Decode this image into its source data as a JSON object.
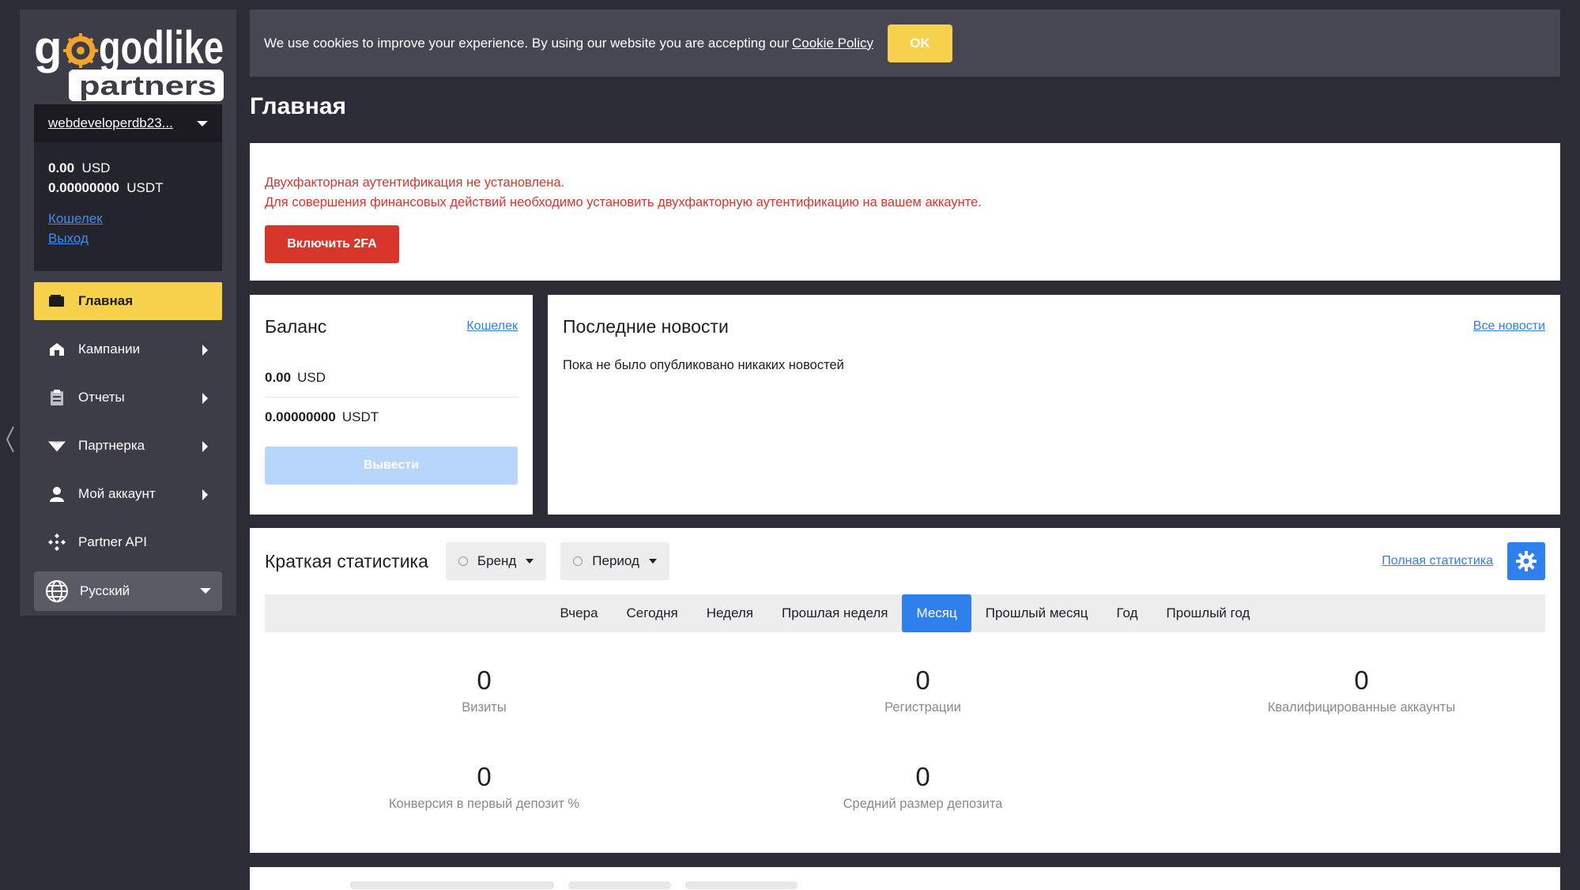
{
  "brand": {
    "line1": "godlike",
    "line2": "partners"
  },
  "account": {
    "username": "webdeveloperdb23...",
    "balances": [
      {
        "amount": "0.00",
        "currency": "USD"
      },
      {
        "amount": "0.00000000",
        "currency": "USDT"
      }
    ],
    "wallet_link": "Кошелек",
    "logout_link": "Выход"
  },
  "nav": [
    {
      "label": "Главная",
      "icon": "wallet-icon",
      "active": true
    },
    {
      "label": "Кампании",
      "icon": "home-icon",
      "submenu": true
    },
    {
      "label": "Отчеты",
      "icon": "clipboard-icon",
      "submenu": true
    },
    {
      "label": "Партнерка",
      "icon": "diamond-icon",
      "submenu": true
    },
    {
      "label": "Мой аккаунт",
      "icon": "user-icon",
      "submenu": true
    },
    {
      "label": "Partner API",
      "icon": "api-icon"
    }
  ],
  "language": "Русский",
  "cookie": {
    "text": "We use cookies to improve your experience. By using our website you are accepting our",
    "link": "Cookie Policy",
    "ok": "OK"
  },
  "page_title": "Главная",
  "alert": {
    "line1": "Двухфакторная аутентификация не установлена.",
    "line2": "Для совершения финансовых действий необходимо установить двухфакторную аутентификацию на вашем аккаунте.",
    "button": "Включить 2FA"
  },
  "balance_card": {
    "title": "Баланс",
    "link": "Кошелек",
    "rows": [
      {
        "amount": "0.00",
        "currency": "USD"
      },
      {
        "amount": "0.00000000",
        "currency": "USDT"
      }
    ],
    "button": "Вывести"
  },
  "news_card": {
    "title": "Последние новости",
    "link": "Все новости",
    "empty": "Пока не было опубликовано никаких новостей"
  },
  "stats": {
    "title": "Краткая статистика",
    "filters": [
      "Бренд",
      "Период"
    ],
    "full_link": "Полная статистика",
    "tabs": [
      "Вчера",
      "Сегодня",
      "Неделя",
      "Прошлая неделя",
      "Месяц",
      "Прошлый месяц",
      "Год",
      "Прошлый год"
    ],
    "active_tab": "Месяц",
    "metrics": [
      {
        "value": "0",
        "label": "Визиты"
      },
      {
        "value": "0",
        "label": "Регистрации"
      },
      {
        "value": "0",
        "label": "Квалифицированные аккаунты"
      },
      {
        "value": "0",
        "label": "Конверсия в первый депозит %"
      },
      {
        "value": "0",
        "label": "Средний размер депозита"
      }
    ]
  },
  "colors": {
    "accent_yellow": "#f7d14c",
    "accent_blue": "#2f80ed",
    "alert_red": "#d9362b",
    "sidebar_bg": "#3d3d48",
    "page_bg": "#2c2c36"
  }
}
